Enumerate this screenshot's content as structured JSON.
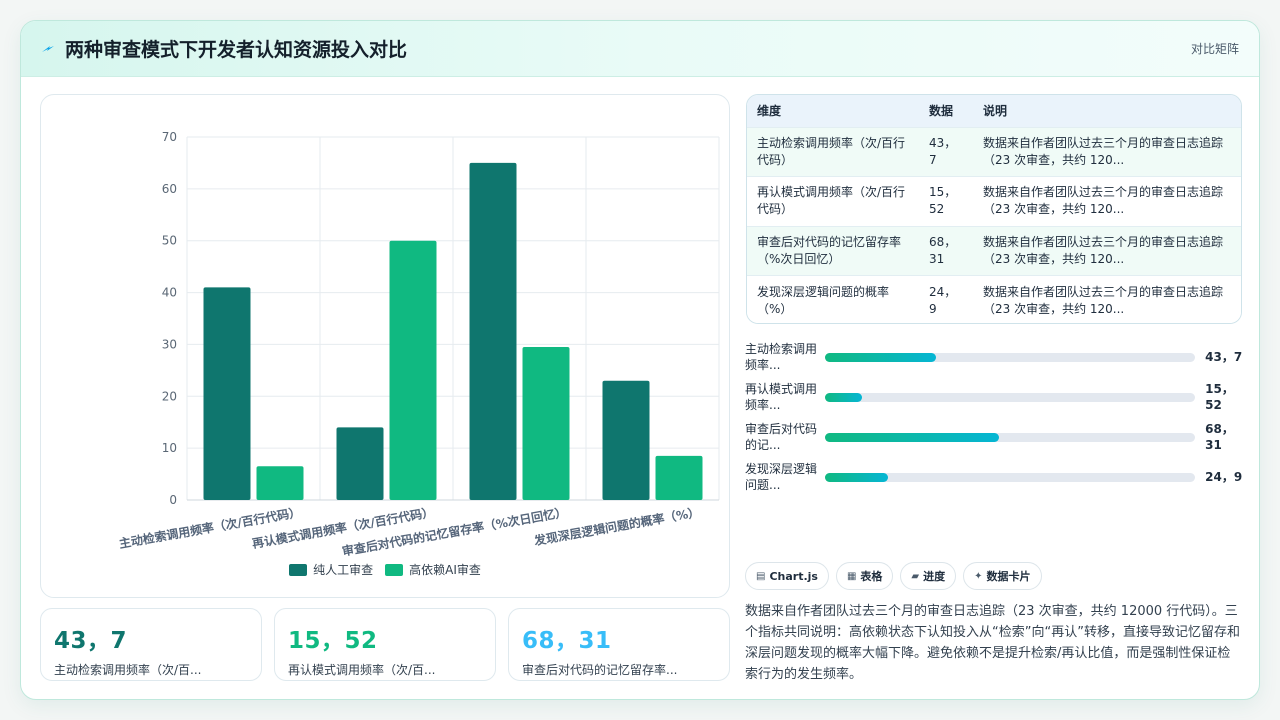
{
  "header": {
    "title": "两种审查模式下开发者认知资源投入对比",
    "action_label": "对比矩阵"
  },
  "colors": {
    "series_1": "#0f766e",
    "series_2": "#10b981",
    "stat_1": "#0f766e",
    "stat_2": "#10b981",
    "stat_3": "#38bdf8"
  },
  "chart_data": {
    "type": "bar",
    "categories": [
      "主动检索调用频率（次/百行代码）",
      "再认模式调用频率（次/百行代码）",
      "审查后对代码的记忆留存率（%次日回忆）",
      "发现深层逻辑问题的概率（%）"
    ],
    "series": [
      {
        "name": "纯人工审查",
        "values": [
          41,
          14,
          65,
          23
        ]
      },
      {
        "name": "高依赖AI审查",
        "values": [
          6.5,
          50,
          29.5,
          8.5
        ]
      }
    ],
    "ylim": [
      0,
      70
    ],
    "yticks": [
      0,
      10,
      20,
      30,
      40,
      50,
      60,
      70
    ],
    "grid": true,
    "legend_position": "bottom"
  },
  "stats": [
    {
      "value": "43，7",
      "label": "主动检索调用频率（次/百..."
    },
    {
      "value": "15，52",
      "label": "再认模式调用频率（次/百..."
    },
    {
      "value": "68，31",
      "label": "审查后对代码的记忆留存率..."
    }
  ],
  "table": {
    "headers": [
      "维度",
      "数据",
      "说明"
    ],
    "rows": [
      {
        "dim": "主动检索调用频率（次/百行代码）",
        "num": "43，7",
        "desc": "数据来自作者团队过去三个月的审查日志追踪（23 次审查，共约 120..."
      },
      {
        "dim": "再认模式调用频率（次/百行代码）",
        "num": "15，52",
        "desc": "数据来自作者团队过去三个月的审查日志追踪（23 次审查，共约 120..."
      },
      {
        "dim": "审查后对代码的记忆留存率（%次日回忆）",
        "num": "68，31",
        "desc": "数据来自作者团队过去三个月的审查日志追踪（23 次审查，共约 120..."
      },
      {
        "dim": "发现深层逻辑问题的概率（%）",
        "num": "24，9",
        "desc": "数据来自作者团队过去三个月的审查日志追踪（23 次审查，共约 120..."
      }
    ]
  },
  "progress": [
    {
      "label": "主动检索调用频率...",
      "value": "43，7",
      "fraction": 0.3
    },
    {
      "label": "再认模式调用频率...",
      "value": "15，52",
      "fraction": 0.1
    },
    {
      "label": "审查后对代码的记...",
      "value": "68，31",
      "fraction": 0.47
    },
    {
      "label": "发现深层逻辑问题...",
      "value": "24，9",
      "fraction": 0.17
    }
  ],
  "tabs": [
    {
      "icon": "▤",
      "label": "Chart.js"
    },
    {
      "icon": "▦",
      "label": "表格"
    },
    {
      "icon": "▰",
      "label": "进度"
    },
    {
      "icon": "✦",
      "label": "数据卡片"
    }
  ],
  "summary": "数据来自作者团队过去三个月的审查日志追踪（23 次审查，共约 12000 行代码）。三个指标共同说明：高依赖状态下认知投入从“检索”向“再认”转移，直接导致记忆留存和深层问题发现的概率大幅下降。避免依赖不是提升检索/再认比值，而是强制性保证检索行为的发生频率。"
}
